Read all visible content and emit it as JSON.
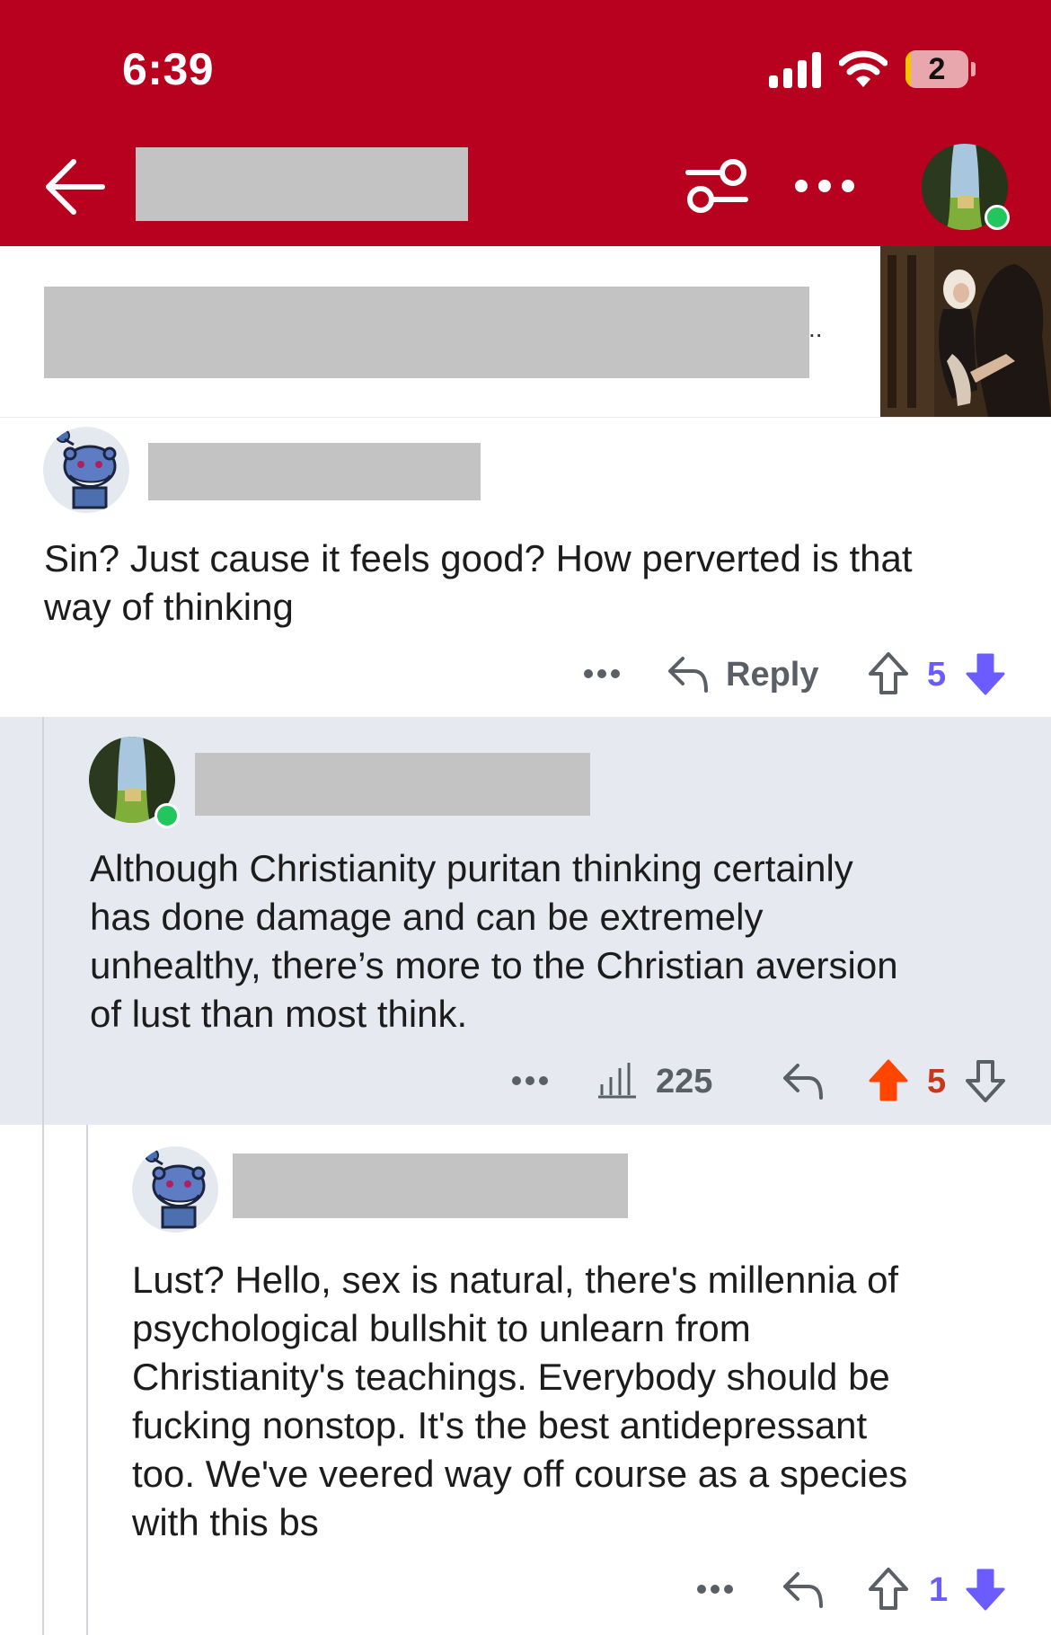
{
  "status_bar": {
    "time": "6:39",
    "battery_level": "2",
    "icons": [
      "signal-icon",
      "wifi-icon",
      "battery-icon"
    ]
  },
  "header": {
    "icons": [
      "back-arrow-icon",
      "filter-sliders-icon",
      "more-horizontal-icon"
    ],
    "background_color": "#b8001f"
  },
  "post": {
    "title_suffix": "..",
    "thumbnail": "painting-thumbnail"
  },
  "comments": [
    {
      "body": "Sin? Just cause it feels good? How perverted is that\nway of thinking",
      "reply_label": "Reply",
      "score": "5",
      "vote_state": "downvoted",
      "vote_color": "#6a5cff"
    },
    {
      "body": "Although Christianity puritan thinking certainly\nhas done damage and can be extremely\nunhealthy, there’s more to the Christian aversion\nof lust than most think.",
      "views": "225",
      "score": "5",
      "vote_state": "upvoted",
      "vote_color": "#ff4500",
      "score_color": "#c7381a"
    },
    {
      "body": "Lust? Hello, sex is natural, there's millennia of\npsychological bullshit to unlearn from\nChristianity's teachings. Everybody should be\nfucking nonstop. It's the best antidepressant\ntoo. We've veered way off course as a species\nwith this bs",
      "score": "1",
      "vote_state": "downvoted",
      "vote_color": "#6a5cff"
    }
  ]
}
